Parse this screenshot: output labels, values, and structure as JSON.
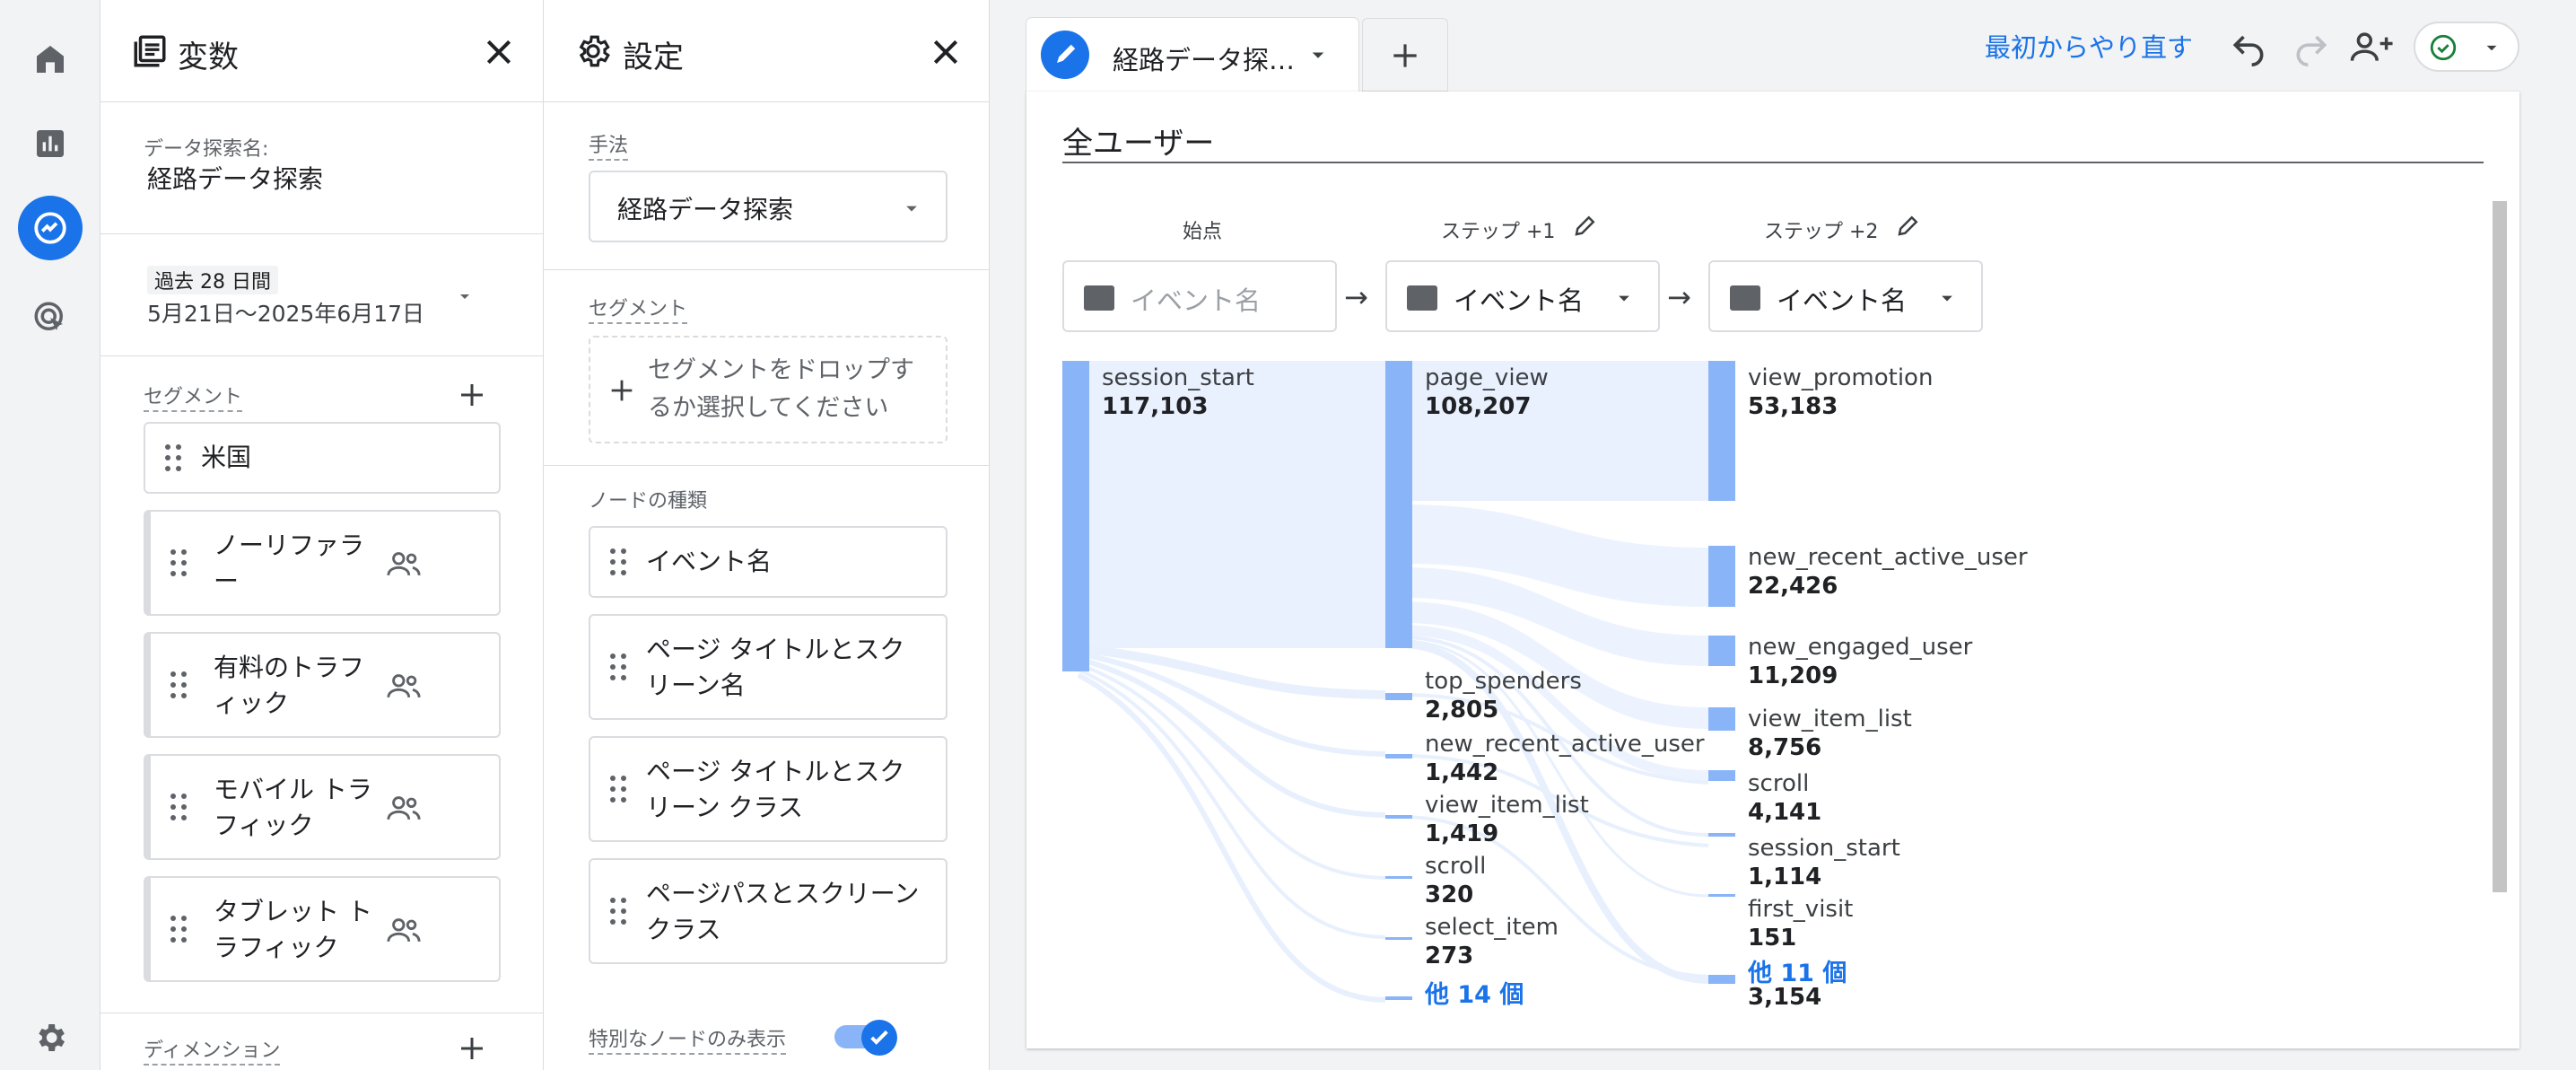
{
  "variables": {
    "title": "変数",
    "exploration_name_label": "データ探索名:",
    "exploration_name": "経路データ探索",
    "date_range_label": "過去 28 日間",
    "date_range": "5月21日～2025年6月17日",
    "segments_label": "セグメント",
    "segments": [
      "米国",
      "ノーリファラー",
      "有料のトラフィック",
      "モバイル トラフィック",
      "タブレット トラフィック"
    ],
    "dimensions_label": "ディメンション"
  },
  "settings": {
    "title": "設定",
    "technique_label": "手法",
    "technique_value": "経路データ探索",
    "segment_label": "セグメント",
    "segment_drop": "セグメントをドロップするか選択してください",
    "node_type_label": "ノードの種類",
    "node_types": [
      "イベント名",
      "ページ タイトルとスクリーン名",
      "ページ タイトルとスクリーン クラス",
      "ページパスとスクリーン クラス"
    ],
    "special_nodes_label": "特別なノードのみ表示",
    "special_nodes_enabled": true
  },
  "header": {
    "tab_label": "経路データ探…",
    "reset_label": "最初からやり直す"
  },
  "canvas": {
    "segment_title": "全ユーザー",
    "steps": [
      {
        "label": "始点",
        "value": "イベント名"
      },
      {
        "label": "ステップ +1",
        "value": "イベント名"
      },
      {
        "label": "ステップ +2",
        "value": "イベント名"
      }
    ]
  },
  "chart_data": {
    "type": "sankey",
    "columns": [
      {
        "nodes": [
          {
            "name": "session_start",
            "value": 117103
          }
        ]
      },
      {
        "nodes": [
          {
            "name": "page_view",
            "value": 108207
          },
          {
            "name": "top_spenders",
            "value": 2805
          },
          {
            "name": "new_recent_active_user",
            "value": 1442
          },
          {
            "name": "view_item_list",
            "value": 1419
          },
          {
            "name": "scroll",
            "value": 320
          },
          {
            "name": "select_item",
            "value": 273
          }
        ],
        "more": "他 14 個"
      },
      {
        "nodes": [
          {
            "name": "view_promotion",
            "value": 53183
          },
          {
            "name": "new_recent_active_user",
            "value": 22426
          },
          {
            "name": "new_engaged_user",
            "value": 11209
          },
          {
            "name": "view_item_list",
            "value": 8756
          },
          {
            "name": "scroll",
            "value": 4141
          },
          {
            "name": "session_start",
            "value": 1114
          },
          {
            "name": "first_visit",
            "value": 151
          }
        ],
        "more": "他 11 個",
        "more_value": 3154
      }
    ]
  },
  "text": {
    "n1": "117,103",
    "n2": "108,207",
    "n3": "2,805",
    "n4": "1,442",
    "n5": "1,419",
    "n6": "320",
    "n7": "273",
    "m1": "53,183",
    "m2": "22,426",
    "m3": "11,209",
    "m4": "8,756",
    "m5": "4,141",
    "m6": "1,114",
    "m7": "151",
    "m8": "3,154"
  },
  "colors": {
    "accent": "#1a73e8",
    "node": "#8ab4f8",
    "flow": "#e8f0fe"
  }
}
